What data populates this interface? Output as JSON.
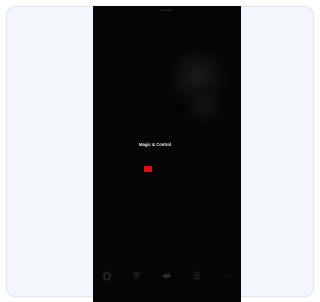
{
  "promo": {
    "title": "Magic & Control",
    "subtitle": "",
    "description": "",
    "dismiss_label": "",
    "cta_label": ""
  },
  "colors": {
    "accent": "#e50914",
    "background": "#050505",
    "card": "#f3f6fa"
  },
  "tabs": [
    {
      "name": "home",
      "icon": "home-icon"
    },
    {
      "name": "sort",
      "icon": "sort-icon"
    },
    {
      "name": "tiles",
      "icon": "tiles-icon"
    },
    {
      "name": "profile",
      "icon": "profile-icon"
    },
    {
      "name": "more",
      "icon": "more-icon"
    }
  ]
}
